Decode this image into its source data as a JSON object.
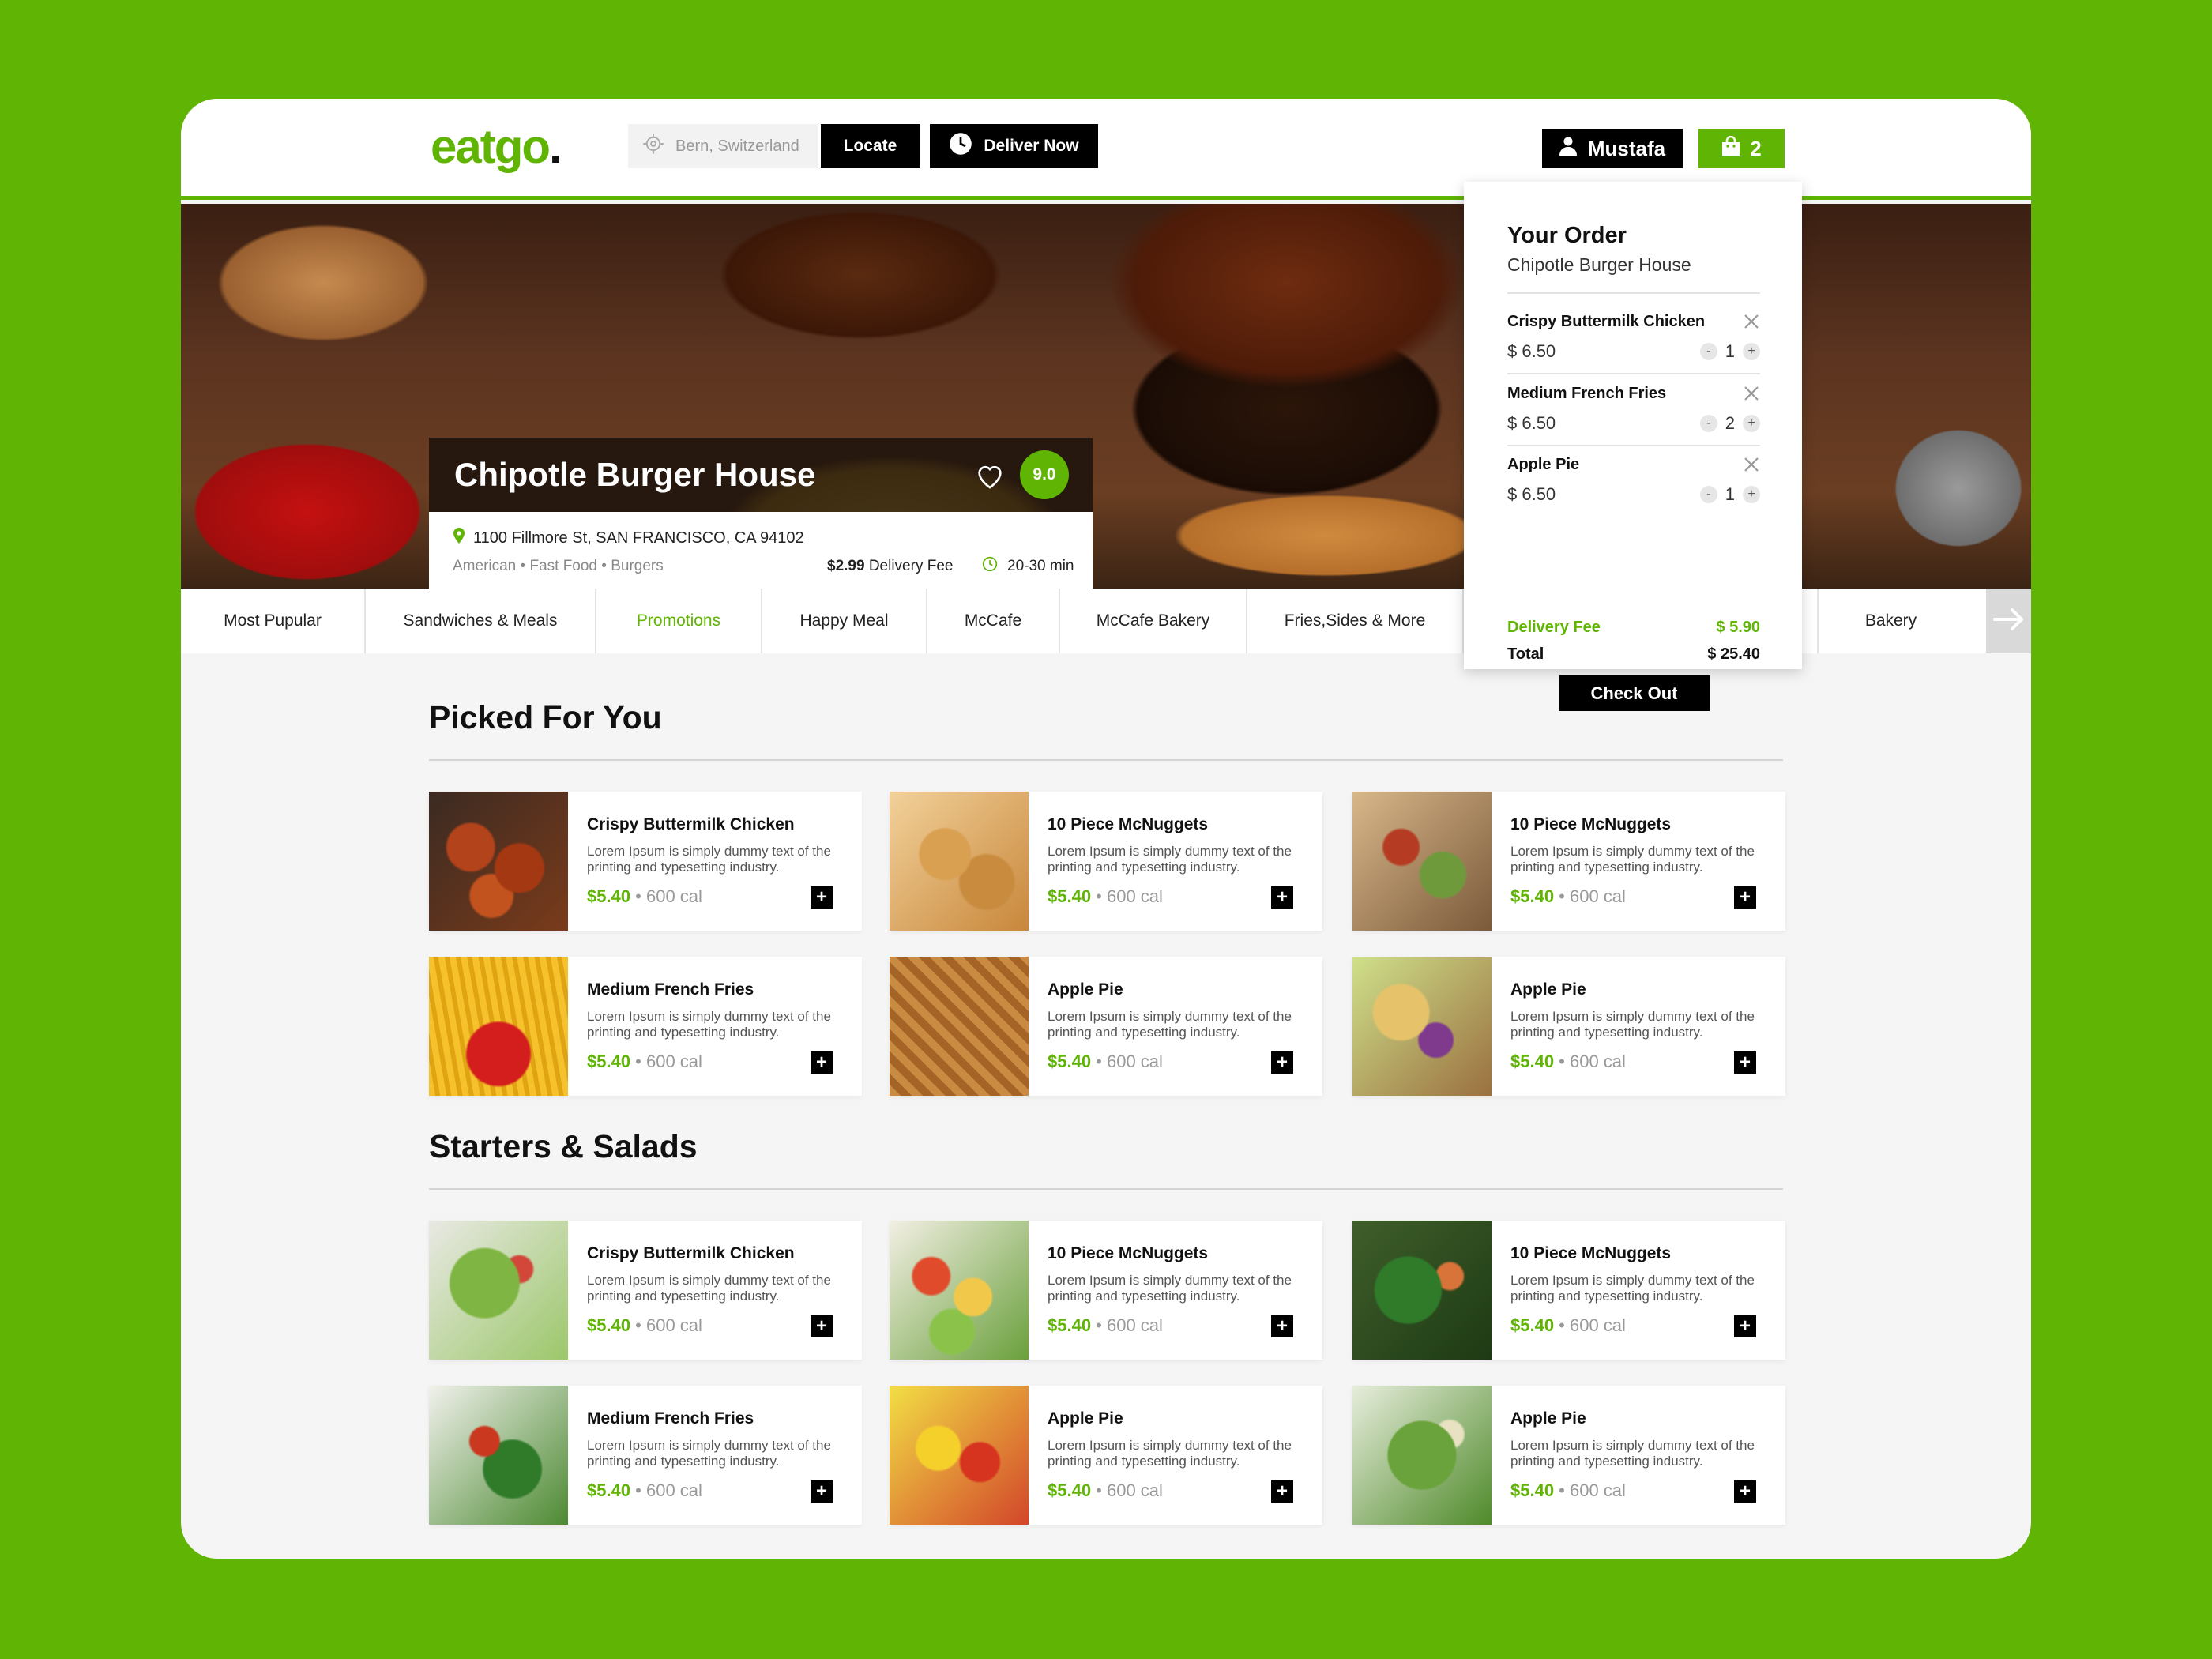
{
  "header": {
    "logo_main": "eatgo",
    "logo_dot": ".",
    "location_placeholder": "Bern, Switzerland",
    "locate_label": "Locate",
    "deliver_label": "Deliver Now",
    "user_name": "Mustafa",
    "cart_count": "2"
  },
  "colors": {
    "brand": "#5fb404",
    "dark": "#000000"
  },
  "restaurant": {
    "name": "Chipotle Burger House",
    "rating": "9.0",
    "address": "1100 Fillmore St, SAN FRANCISCO, CA 94102",
    "cuisine": "American • Fast Food • Burgers",
    "fee_amount": "$2.99",
    "fee_label": "Delivery Fee",
    "eta": "20-30 min"
  },
  "categories": [
    "Most Pupular",
    "Sandwiches & Meals",
    "Promotions",
    "Happy Meal",
    "McCafe",
    "McCafe Bakery",
    "Fries,Sides & More",
    "Bakery"
  ],
  "order": {
    "title": "Your Order",
    "restaurant": "Chipotle Burger House",
    "items": [
      {
        "name": "Crispy Buttermilk Chicken",
        "price": "$ 6.50",
        "qty": "1"
      },
      {
        "name": "Medium French Fries",
        "price": "$ 6.50",
        "qty": "2"
      },
      {
        "name": "Apple Pie",
        "price": "$ 6.50",
        "qty": "1"
      }
    ],
    "delivery_label": "Delivery Fee",
    "delivery_value": "$ 5.90",
    "total_label": "Total",
    "total_value": "$ 25.40",
    "checkout_label": "Check Out"
  },
  "sections": [
    {
      "title": "Picked For You",
      "items": [
        {
          "name": "Crispy Buttermilk Chicken",
          "desc": "Lorem Ipsum is simply dummy text of the printing and typesetting industry.",
          "price": "$5.40",
          "cal": " • 600 cal"
        },
        {
          "name": "10 Piece McNuggets",
          "desc": "Lorem Ipsum is simply dummy text of the printing and typesetting industry.",
          "price": "$5.40",
          "cal": " • 600 cal"
        },
        {
          "name": "10 Piece McNuggets",
          "desc": "Lorem Ipsum is simply dummy text of the printing and typesetting industry.",
          "price": "$5.40",
          "cal": " • 600 cal"
        },
        {
          "name": "Medium French Fries",
          "desc": "Lorem Ipsum is simply dummy text of the printing and typesetting industry.",
          "price": "$5.40",
          "cal": " • 600 cal"
        },
        {
          "name": "Apple Pie",
          "desc": "Lorem Ipsum is simply dummy text of the printing and typesetting industry.",
          "price": "$5.40",
          "cal": " • 600 cal"
        },
        {
          "name": "Apple Pie",
          "desc": "Lorem Ipsum is simply dummy text of the printing and typesetting industry.",
          "price": "$5.40",
          "cal": " • 600 cal"
        }
      ]
    },
    {
      "title": "Starters & Salads",
      "items": [
        {
          "name": "Crispy Buttermilk Chicken",
          "desc": "Lorem Ipsum is simply dummy text of the printing and typesetting industry.",
          "price": "$5.40",
          "cal": " • 600 cal"
        },
        {
          "name": "10 Piece McNuggets",
          "desc": "Lorem Ipsum is simply dummy text of the printing and typesetting industry.",
          "price": "$5.40",
          "cal": " • 600 cal"
        },
        {
          "name": "10 Piece McNuggets",
          "desc": "Lorem Ipsum is simply dummy text of the printing and typesetting industry.",
          "price": "$5.40",
          "cal": " • 600 cal"
        },
        {
          "name": "Medium French Fries",
          "desc": "Lorem Ipsum is simply dummy text of the printing and typesetting industry.",
          "price": "$5.40",
          "cal": " • 600 cal"
        },
        {
          "name": "Apple Pie",
          "desc": "Lorem Ipsum is simply dummy text of the printing and typesetting industry.",
          "price": "$5.40",
          "cal": " • 600 cal"
        },
        {
          "name": "Apple Pie",
          "desc": "Lorem Ipsum is simply dummy text of the printing and typesetting industry.",
          "price": "$5.40",
          "cal": " • 600 cal"
        }
      ]
    }
  ]
}
